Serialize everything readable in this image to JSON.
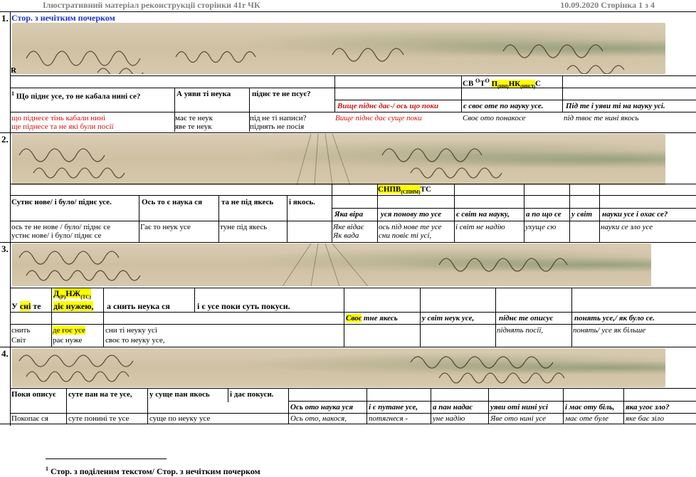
{
  "header": {
    "left": "Ілюстративний матеріал  реконструкції сторінки 41r ЧК",
    "right": "10.09.2020  Сторінка 1 з 4"
  },
  "sec1": {
    "num": "1.",
    "title": "Стор. з нечітким почерком",
    "marker": "R",
    "sup": "1",
    "row_top": [
      "Що піднє усе, то не кабала нині се?",
      "А уяви ті неука",
      "піднє те не псує?"
    ],
    "right_header": "СВ ОТО П(НН)НК(ННЛ)С",
    "right_row": [
      "Вище піднє дає-/ ось що поки",
      "є своє оте по науку усе.",
      "Під те і уяви ті на науку усі."
    ],
    "bottom_left": [
      "що піднесе тінь кабали нині",
      "ще піднесе та не які були посії"
    ],
    "bottom_mid1": [
      "має те неук",
      "яве те неук"
    ],
    "bottom_mid2": [
      "під не ті написи?",
      "піднять не посія"
    ],
    "bottom_right": [
      "Вище піднє дає суще поки",
      "Своє ото понакосе",
      "під твоє те нині якось"
    ]
  },
  "sec2": {
    "num": "2.",
    "header": "СНПВ(СПНМ)ТС",
    "row_top": [
      "Сутнє нове/ і було/ піднє усе.",
      "Ось то є наука ся",
      "та не під якесь",
      "і якось."
    ],
    "right_row": [
      "Яка віра",
      "уся понову то усе",
      "є світ на науку,",
      "а по що се",
      "у світ",
      "науки усе і охає се?"
    ],
    "bottom_left": [
      "ось те не нове / було/ піднє се",
      "устнє нове/ і було/ піднє се"
    ],
    "bottom_mid1": "Гає то неук усе",
    "bottom_mid2": "туне під якесь",
    "bottom_right": [
      "Яке відає",
      "Як вада"
    ],
    "bottom_right2": [
      "ось під нове те усе",
      "сни повіє ті усі,"
    ],
    "bottom_right3": "і світ не надію",
    "bottom_right4": "ухуще сю",
    "bottom_right5": "науки се зло усе"
  },
  "sec3": {
    "num": "3.",
    "header": "Д(Р)НЖ(ТС)",
    "row_top": [
      "У сні те",
      "діє нужею,",
      "а снить неука ся",
      "і є усе поки суть покуси."
    ],
    "right_row": [
      "Своє тне якесь",
      "у світ неук усе,",
      "піднє те описує",
      "понять усе,/ як було се."
    ],
    "bottom_left": [
      "снить",
      "Світ"
    ],
    "bottom_mid1": [
      "де гоє усе",
      "рає нуже"
    ],
    "bottom_mid2": [
      "сни ті неуку усі",
      "своє то неуку усе,"
    ],
    "bottom_right1": "піднять посії,",
    "bottom_right2": "понять/ усе як більше"
  },
  "sec4": {
    "num": "4.",
    "row_top": [
      "Поки описує",
      "суте пан на те усе,",
      "у суще пан якось",
      "і дає покуси."
    ],
    "right_row": [
      "Ось ото наука уся",
      "і є путане усе,",
      "а пан надає",
      "уяви оті нині усі",
      "і має оту біль,",
      "яка угоє зло?"
    ],
    "bottom": [
      "Покопає ся",
      "суте понині те усе",
      "суще по неуку усе",
      "Ось ото, накося,",
      "потягнеся -",
      "уне надію",
      "Яве ото нині усе",
      "має оте буле",
      "яке бає зіло"
    ]
  },
  "footnote": {
    "sup": "1",
    "text": "Стор. з поділеним текстом/ Стор. з нечітким почерком"
  }
}
